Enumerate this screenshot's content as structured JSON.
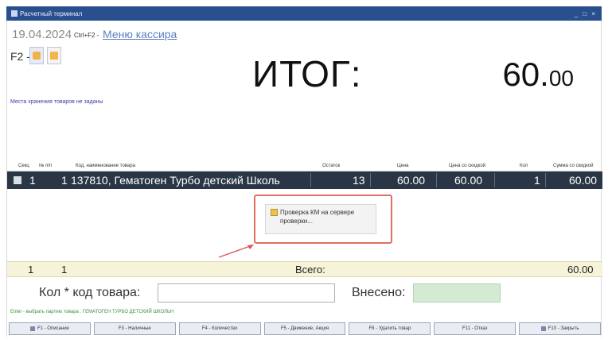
{
  "window": {
    "title": "Расчетный терминал",
    "controls": "_ □ ×"
  },
  "header": {
    "date": "19.04.2024",
    "shortcut": "Ctrl+F2 -",
    "cashier_menu": "Меню кассира",
    "f2_label": "F2 -",
    "total_label": "ИТОГ:",
    "total_int": "60.",
    "total_dec": "00",
    "storage_note": "Места хранения товаров не заданы"
  },
  "table": {
    "columns": [
      "Секц",
      "№ п/п",
      "Код, наименование товара",
      "Остаток",
      "Цена",
      "Цена со скидкой",
      "Кол",
      "Сумма со скидкой"
    ],
    "rows": [
      {
        "section": "1",
        "num": "1",
        "name": "137810, Гематоген Турбо детский Школь",
        "stock": "13",
        "price": "60.00",
        "disc_price": "60.00",
        "qty": "1",
        "sum": "60.00"
      }
    ]
  },
  "popup": {
    "message": "Проверка КМ на сервере проверки..."
  },
  "totals": {
    "section": "1",
    "count": "1",
    "label": "Всего:",
    "sum": "60.00"
  },
  "input": {
    "qty_label": "Кол * код товара:",
    "paid_label": "Внесено:",
    "qty_value": ""
  },
  "hint": "Enter - выбрать партию товара : ГЕМАТОГЕН ТУРБО ДЕТСКИЙ ШКОЛЬН",
  "fkeys": [
    "F1 - Описание",
    "F3 - Наличные",
    "F4 - Количество",
    "F5 - Движение, Акция",
    "F8 - Удалить товар",
    "F11 - Отказ",
    "F10 - Закрыть"
  ]
}
